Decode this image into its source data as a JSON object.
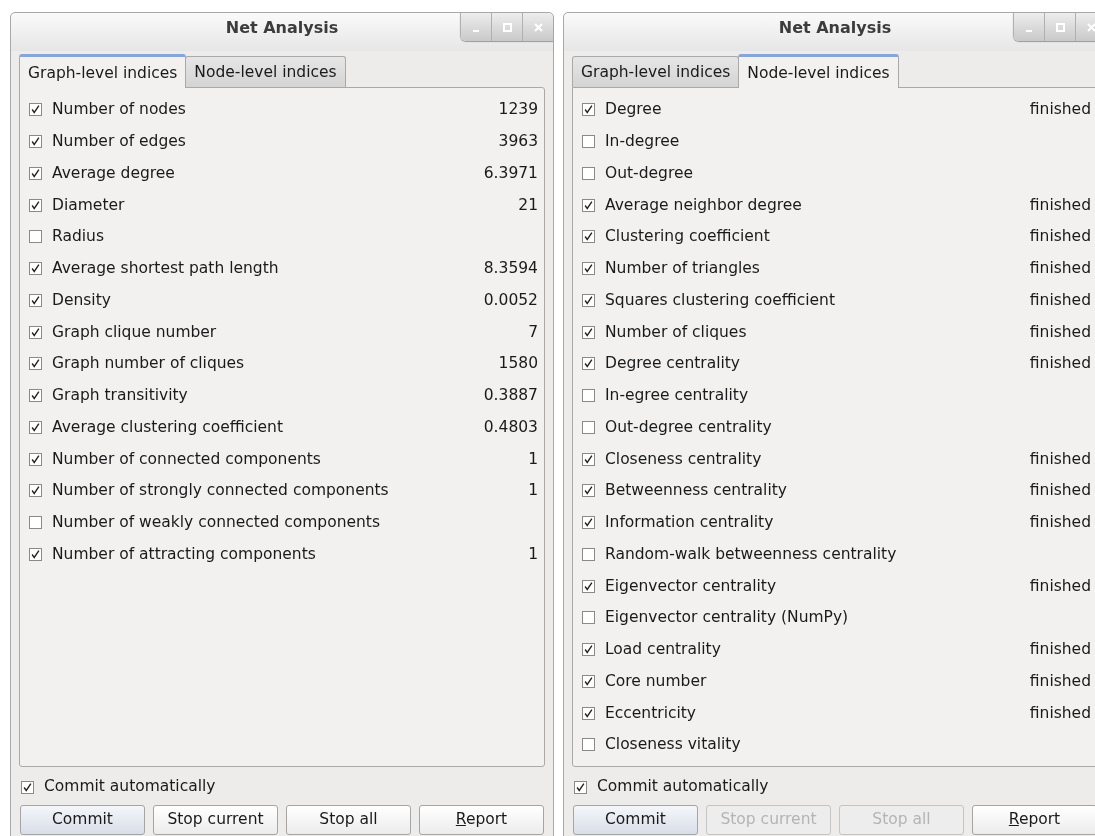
{
  "windows": [
    {
      "title": "Net Analysis",
      "tabs": [
        {
          "label": "Graph-level indices",
          "selected": true
        },
        {
          "label": "Node-level indices",
          "selected": false
        }
      ],
      "indices": [
        {
          "label": "Number of nodes",
          "checked": true,
          "value": "1239"
        },
        {
          "label": "Number of edges",
          "checked": true,
          "value": "3963"
        },
        {
          "label": "Average degree",
          "checked": true,
          "value": "6.3971"
        },
        {
          "label": "Diameter",
          "checked": true,
          "value": "21"
        },
        {
          "label": "Radius",
          "checked": false
        },
        {
          "label": "Average shortest path length",
          "checked": true,
          "value": "8.3594"
        },
        {
          "label": "Density",
          "checked": true,
          "value": "0.0052"
        },
        {
          "label": "Graph clique number",
          "checked": true,
          "value": "7"
        },
        {
          "label": "Graph number of cliques",
          "checked": true,
          "value": "1580"
        },
        {
          "label": "Graph transitivity",
          "checked": true,
          "value": "0.3887"
        },
        {
          "label": "Average clustering coefficient",
          "checked": true,
          "value": "0.4803"
        },
        {
          "label": "Number of connected components",
          "checked": true,
          "value": "1"
        },
        {
          "label": "Number of strongly connected components",
          "checked": true,
          "value": "1"
        },
        {
          "label": "Number of weakly connected components",
          "checked": false
        },
        {
          "label": "Number of attracting components",
          "checked": true,
          "value": "1"
        }
      ],
      "commit_automatically": {
        "label": "Commit automatically",
        "checked": true
      },
      "buttons": [
        {
          "label": "Commit",
          "disabled": false,
          "default": true,
          "underline_first": false
        },
        {
          "label": "Stop current",
          "disabled": false,
          "default": false,
          "underline_first": false
        },
        {
          "label": "Stop all",
          "disabled": false,
          "default": false,
          "underline_first": false
        },
        {
          "label": "Report",
          "disabled": false,
          "default": false,
          "underline_first": true
        }
      ]
    },
    {
      "title": "Net Analysis",
      "tabs": [
        {
          "label": "Graph-level indices",
          "selected": false
        },
        {
          "label": "Node-level indices",
          "selected": true
        }
      ],
      "indices": [
        {
          "label": "Degree",
          "checked": true,
          "value": "finished"
        },
        {
          "label": "In-degree",
          "checked": false
        },
        {
          "label": "Out-degree",
          "checked": false
        },
        {
          "label": "Average neighbor degree",
          "checked": true,
          "value": "finished"
        },
        {
          "label": "Clustering coefficient",
          "checked": true,
          "value": "finished"
        },
        {
          "label": "Number of triangles",
          "checked": true,
          "value": "finished"
        },
        {
          "label": "Squares clustering coefficient",
          "checked": true,
          "value": "finished"
        },
        {
          "label": "Number of cliques",
          "checked": true,
          "value": "finished"
        },
        {
          "label": "Degree centrality",
          "checked": true,
          "value": "finished"
        },
        {
          "label": "In-egree centrality",
          "checked": false
        },
        {
          "label": "Out-degree centrality",
          "checked": false
        },
        {
          "label": "Closeness centrality",
          "checked": true,
          "value": "finished"
        },
        {
          "label": "Betweenness centrality",
          "checked": true,
          "value": "finished"
        },
        {
          "label": "Information centrality",
          "checked": true,
          "value": "finished"
        },
        {
          "label": "Random-walk betweenness centrality",
          "checked": false
        },
        {
          "label": "Eigenvector centrality",
          "checked": true,
          "value": "finished"
        },
        {
          "label": "Eigenvector centrality (NumPy)",
          "checked": false
        },
        {
          "label": "Load centrality",
          "checked": true,
          "value": "finished"
        },
        {
          "label": "Core number",
          "checked": true,
          "value": "finished"
        },
        {
          "label": "Eccentricity",
          "checked": true,
          "value": "finished"
        },
        {
          "label": "Closeness vitality",
          "checked": false
        }
      ],
      "commit_automatically": {
        "label": "Commit automatically",
        "checked": true
      },
      "buttons": [
        {
          "label": "Commit",
          "disabled": false,
          "default": true,
          "underline_first": false
        },
        {
          "label": "Stop current",
          "disabled": true,
          "default": false,
          "underline_first": false
        },
        {
          "label": "Stop all",
          "disabled": true,
          "default": false,
          "underline_first": false
        },
        {
          "label": "Report",
          "disabled": false,
          "default": false,
          "underline_first": true
        }
      ]
    }
  ]
}
